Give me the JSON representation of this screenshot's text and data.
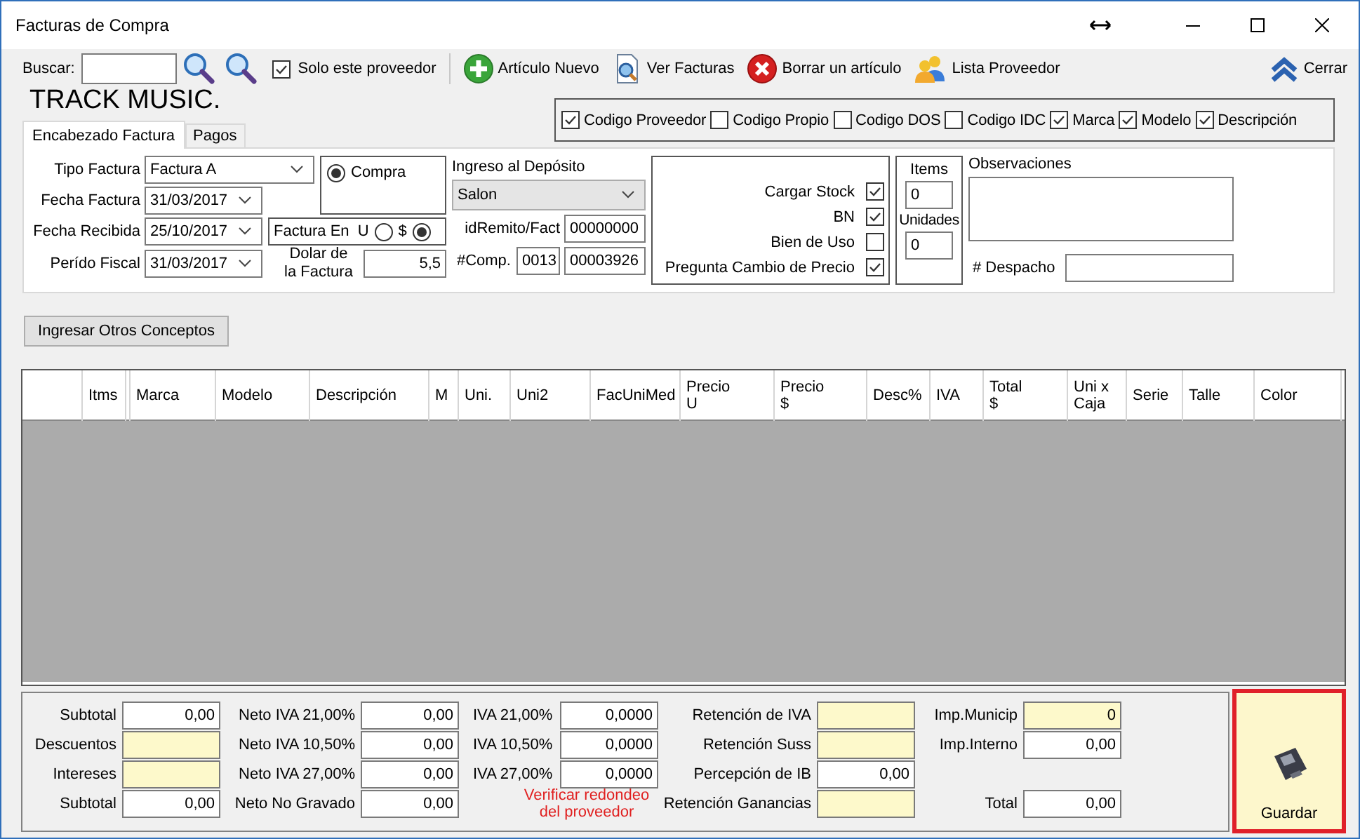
{
  "window": {
    "title": "Facturas de Compra"
  },
  "toolbar": {
    "search_label": "Buscar:",
    "only_supplier": {
      "label": "Solo este proveedor",
      "checked": true
    },
    "buttons": [
      {
        "label": "Artículo Nuevo",
        "kind": "add"
      },
      {
        "label": "Ver Facturas",
        "kind": "view"
      },
      {
        "label": "Borrar un artículo",
        "kind": "delete"
      },
      {
        "label": "Lista Proveedor",
        "kind": "people"
      }
    ],
    "close": {
      "label": "Cerrar"
    }
  },
  "company": "TRACK MUSIC.",
  "code_options": [
    {
      "label": "Codigo Proveedor",
      "checked": true
    },
    {
      "label": "Codigo Propio",
      "checked": false
    },
    {
      "label": "Codigo DOS",
      "checked": false
    },
    {
      "label": "Codigo IDC",
      "checked": false
    },
    {
      "label": "Marca",
      "checked": true
    },
    {
      "label": "Modelo",
      "checked": true
    },
    {
      "label": "Descripción",
      "checked": true
    }
  ],
  "tabs": [
    {
      "label": "Encabezado Factura",
      "selected": true
    },
    {
      "label": "Pagos",
      "selected": false
    }
  ],
  "header": {
    "invoice_type": {
      "label": "Tipo Factura",
      "value": "Factura A"
    },
    "dates": [
      {
        "label": "Fecha Factura",
        "value": "31/03/2017"
      },
      {
        "label": "Fecha Recibida",
        "value": "25/10/2017"
      },
      {
        "label": "Perído Fiscal",
        "value": "31/03/2017"
      }
    ],
    "purchase_option": {
      "label": "Compra",
      "selected": true
    },
    "currency": {
      "label": "Factura En",
      "options": [
        {
          "label": "U",
          "selected": false
        },
        {
          "label": "$",
          "selected": true
        }
      ]
    },
    "exchange_rate": {
      "label": "Dolar de\nla Factura",
      "value": "5,5"
    },
    "deposit": {
      "label": "Ingreso al Depósito",
      "value": "Salon"
    },
    "remito": {
      "label": "idRemito/Fact",
      "value": "00000000"
    },
    "comp": {
      "label": "#Comp.",
      "point_of_sale": "0013",
      "number": "00003926"
    },
    "flags": [
      {
        "label": "Cargar Stock",
        "checked": true
      },
      {
        "label": "BN",
        "checked": true
      },
      {
        "label": "Bien de Uso",
        "checked": false
      },
      {
        "label": "Pregunta Cambio de Precio",
        "checked": true
      }
    ],
    "items": {
      "label": "Items",
      "value": "0"
    },
    "units": {
      "label": "Unidades",
      "value": "0"
    },
    "notes": {
      "label": "Observaciones"
    },
    "dispatch": {
      "label": "# Despacho"
    }
  },
  "other_concepts_button": "Ingresar Otros Conceptos",
  "table": {
    "columns": [
      "Itms",
      "Marca",
      "Modelo",
      "Descripción",
      "M",
      "Uni.",
      "Uni2",
      "FacUniMed",
      "Precio\nU",
      "Precio\n$",
      "Desc%",
      "IVA",
      "Total\n$",
      "Uni x\nCaja",
      "Serie",
      "Talle",
      "Color"
    ]
  },
  "totals": {
    "groups": [
      {
        "fields": [
          {
            "label": "Subtotal",
            "value": "0,00",
            "highlighted": false
          },
          {
            "label": "Descuentos",
            "highlighted": true
          },
          {
            "label": "Intereses",
            "highlighted": true
          },
          {
            "label": "Subtotal",
            "value": "0,00",
            "highlighted": false
          }
        ]
      },
      {
        "fields": [
          {
            "label": "Neto IVA 21,00%",
            "value": "0,00",
            "highlighted": false
          },
          {
            "label": "Neto IVA 10,50%",
            "value": "0,00",
            "highlighted": false
          },
          {
            "label": "Neto IVA 27,00%",
            "value": "0,00",
            "highlighted": false
          },
          {
            "label": "Neto No Gravado",
            "value": "0,00",
            "highlighted": false
          }
        ]
      },
      {
        "fields": [
          {
            "label": "IVA 21,00%",
            "value": "0,0000",
            "highlighted": false
          },
          {
            "label": "IVA 10,50%",
            "value": "0,0000",
            "highlighted": false
          },
          {
            "label": "IVA 27,00%",
            "value": "0,0000",
            "highlighted": false
          }
        ],
        "note": "Verificar redondeo\ndel proveedor"
      },
      {
        "fields": [
          {
            "label": "Retención de IVA",
            "highlighted": true
          },
          {
            "label": "Retención Suss",
            "highlighted": true
          },
          {
            "label": "Percepción de IB",
            "value": "0,00",
            "highlighted": false
          },
          {
            "label": "Retención Ganancias",
            "highlighted": true
          }
        ]
      },
      {
        "fields": [
          {
            "label": "Imp.Municip",
            "value": "0",
            "highlighted": true
          },
          {
            "label": "Imp.Interno",
            "value": "0,00",
            "highlighted": false
          }
        ],
        "total": {
          "label": "Total",
          "value": "0,00"
        }
      }
    ]
  },
  "save_button": "Guardar"
}
